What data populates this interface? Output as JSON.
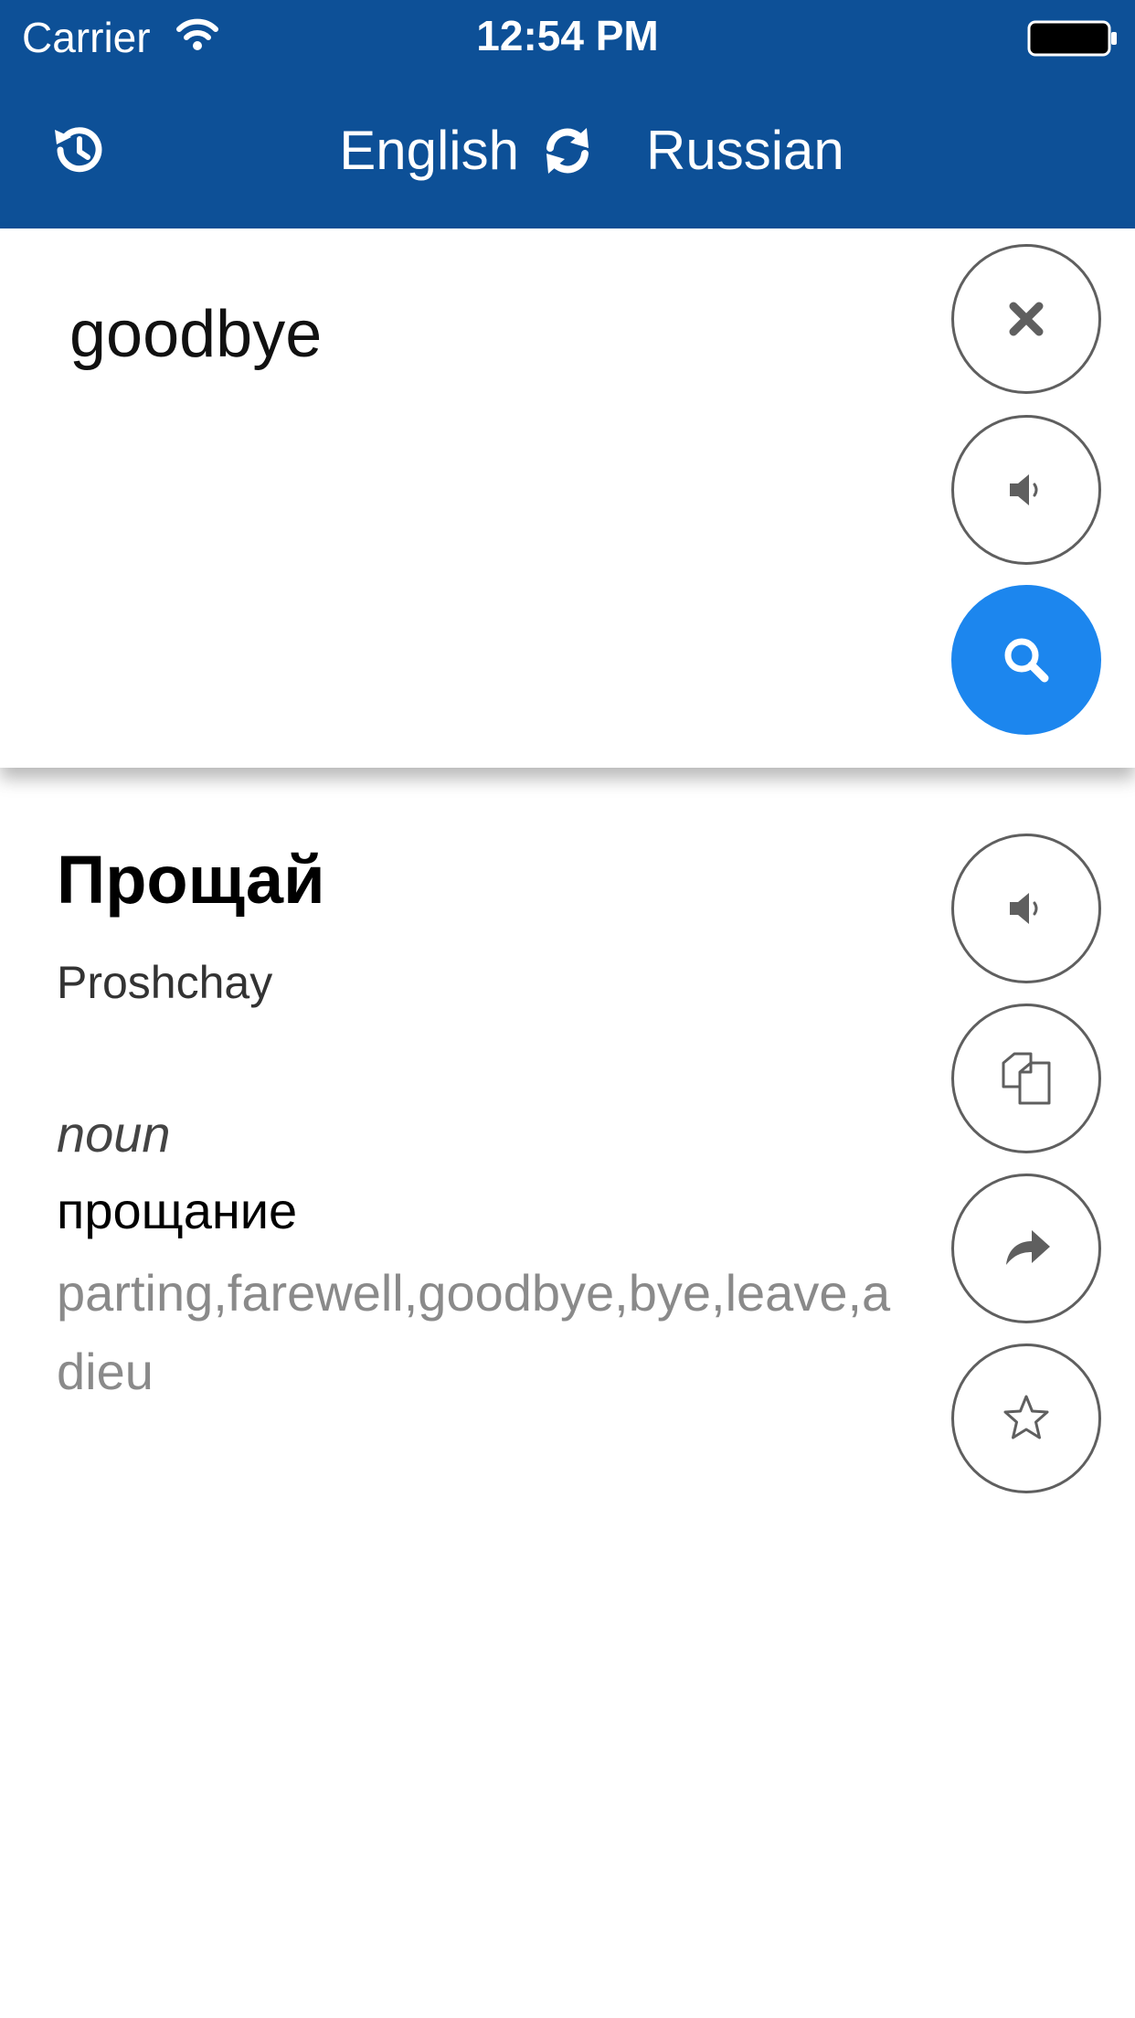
{
  "status": {
    "carrier": "Carrier",
    "time": "12:54 PM"
  },
  "header": {
    "source_language": "English",
    "target_language": "Russian"
  },
  "input": {
    "text": "goodbye"
  },
  "result": {
    "title": "Прощай",
    "transliteration": "Proshchay",
    "part_of_speech": "noun",
    "word": "прощание",
    "synonyms": "parting,farewell,goodbye,bye,leave,adieu"
  },
  "icons": {
    "history": "history-icon",
    "swap": "refresh-icon",
    "clear": "close-icon",
    "speak": "speaker-icon",
    "search": "search-icon",
    "copy": "copy-icon",
    "share": "share-icon",
    "favorite": "star-icon"
  },
  "colors": {
    "header_bg": "#0d5097",
    "accent": "#1c86ee",
    "icon_gray": "#5f5f5f"
  }
}
